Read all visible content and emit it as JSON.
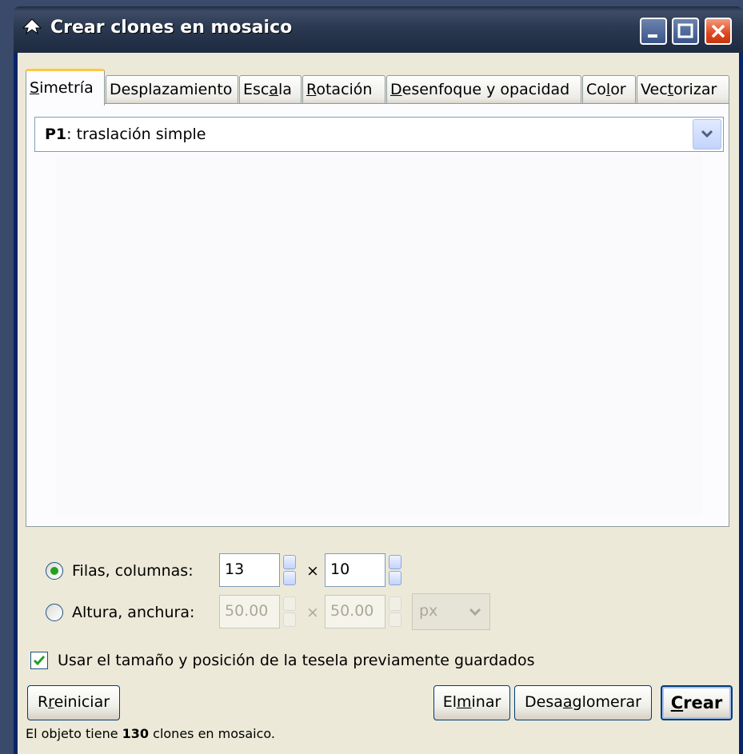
{
  "window": {
    "title": "Crear clones en mosaico",
    "icon": "inkscape-icon"
  },
  "titlebar_buttons": {
    "minimize": "minimize-icon",
    "maximize": "maximize-icon",
    "close": "close-icon"
  },
  "tabs": [
    {
      "label": "Simetría",
      "mnemonic": "S",
      "rest": "imetría",
      "active": true
    },
    {
      "label": "Desplazamiento",
      "active": false
    },
    {
      "label": "Escala",
      "pre": "Esc",
      "mnemonic": "a",
      "rest": "la",
      "active": false
    },
    {
      "label": "Rotación",
      "mnemonic": "R",
      "rest": "otación",
      "active": false
    },
    {
      "label": "Desenfoque y opacidad",
      "mnemonic": "D",
      "rest": "esenfoque y opacidad",
      "active": false
    },
    {
      "label": "Color",
      "pre": "Co",
      "mnemonic": "l",
      "rest": "or",
      "active": false
    },
    {
      "label": "Vectorizar",
      "pre": "Vec",
      "mnemonic": "t",
      "rest": "orizar",
      "active": false
    }
  ],
  "symmetry_select": {
    "value_bold": "P1",
    "value_rest": ": traslación simple"
  },
  "size_options": {
    "rows_cols": {
      "label": "Filas, columnas:",
      "selected": true,
      "rows": "13",
      "cols": "10",
      "separator": "×"
    },
    "height_width": {
      "label": "Altura, anchura:",
      "selected": false,
      "height": "50.00",
      "width": "50.00",
      "separator": "×",
      "unit": "px"
    }
  },
  "use_saved": {
    "label": "Usar el tamaño y posición de la tesela previamente guardados",
    "checked": true
  },
  "buttons": {
    "reset": {
      "label": "Rreiniciar",
      "pre": "R",
      "mnemonic": "r",
      "rest": "einiciar"
    },
    "remove": {
      "label": "Elminar",
      "pre": "El",
      "mnemonic": "m",
      "rest": "inar"
    },
    "unclump": {
      "label": "Desaaglomerar",
      "pre": "Desa",
      "mnemonic": "a",
      "rest": "glomerar"
    },
    "create": {
      "label": "Crear",
      "mnemonic": "C",
      "rest": "rear"
    }
  },
  "status": {
    "prefix": "El objeto tiene ",
    "count": "130",
    "suffix": " clones en mosaico."
  },
  "colors": {
    "active_tab_accent": "#ffc83c",
    "radio_dot": "#21a121",
    "check_mark": "#21a121",
    "close_button": "#e0471f"
  }
}
